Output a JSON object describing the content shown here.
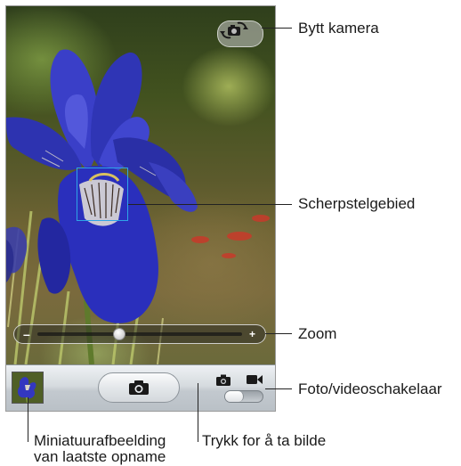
{
  "camera": {
    "switch_camera_icon": "camera-rotate-icon",
    "shutter_icon": "camera-icon",
    "mode_photo_icon": "camera-icon",
    "mode_video_icon": "video-camera-icon",
    "zoom_level": 0.4,
    "mode": "photo",
    "zoom_minus": "–",
    "zoom_plus": "+"
  },
  "callouts": {
    "switch_camera": "Bytt kamera",
    "focus_area": "Scherpstelgebied",
    "zoom": "Zoom",
    "mode_switch": "Foto/videoschakelaar",
    "shutter": "Trykk for å ta bilde",
    "thumbnail_line1": "Miniatuurafbeelding",
    "thumbnail_line2": "van laatste opname"
  },
  "colors": {
    "focus_box": "#2ea4e8",
    "iris_petal": "#2a2fb8",
    "leader_line": "#222222"
  }
}
